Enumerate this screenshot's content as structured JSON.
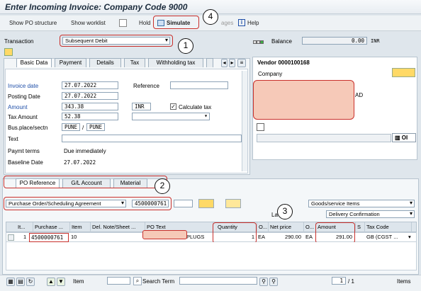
{
  "title": "Enter Incoming Invoice: Company Code 9000",
  "toolbar": {
    "show_po": "Show PO structure",
    "show_worklist": "Show worklist",
    "hold": "Hold",
    "simulate": "Simulate",
    "messages": "ages",
    "help": "Help"
  },
  "header": {
    "transaction_label": "Transaction",
    "transaction_value": "Subsequent Debit",
    "balance_label": "Balance",
    "balance_value": "0.00",
    "currency": "INR"
  },
  "tabs": [
    "Basic Data",
    "Payment",
    "Details",
    "Tax",
    "Withholding tax"
  ],
  "basic": {
    "invoice_date_label": "Invoice date",
    "invoice_date": "27.07.2022",
    "reference_label": "Reference",
    "posting_date_label": "Posting Date",
    "posting_date": "27.07.2022",
    "amount_label": "Amount",
    "amount": "343.38",
    "amount_curr": "INR",
    "calc_tax": "Calculate tax",
    "tax_amount_label": "Tax Amount",
    "tax_amount": "52.38",
    "bus_place_label": "Bus.place/sectn",
    "bus_place": "PUNE",
    "section": "PUNE",
    "text_label": "Text",
    "paymt_label": "Paymt terms",
    "paymt_value": "Due immediately",
    "baseline_label": "Baseline Date",
    "baseline_value": "27.07.2022"
  },
  "vendor": {
    "title": "Vendor 0000100168",
    "company_label": "Company",
    "partial": "AD",
    "oi": "OI"
  },
  "po_tabs": [
    "PO Reference",
    "G/L Account",
    "Material"
  ],
  "po": {
    "ref_type": "Purchase Order/Scheduling Agreement",
    "po_number": "4500000761",
    "goods": "Goods/service Items",
    "delivery": "Delivery Confirmation",
    "layout": "La"
  },
  "grid": {
    "headers": [
      "It...",
      "Purchase ...",
      "Item",
      "Del. Note/Sheet ...",
      "PO Text",
      "Quantity",
      "O...",
      "Net price",
      "O...",
      "Amount",
      "S",
      "Tax Code"
    ],
    "row": {
      "it": "1",
      "po": "4500000761",
      "item": "10",
      "po_text": "PLUGS",
      "quantity": "1",
      "ord_unit": "EA",
      "net_price": "290.00",
      "price_unit": "EA",
      "amount": "291.00",
      "tax_code": "GB (CGST ..."
    }
  },
  "footer": {
    "item_label": "Item",
    "search_label": "Search Term",
    "page": "1",
    "total": "/ 1",
    "items": "Items"
  },
  "callouts": [
    "1",
    "2",
    "3",
    "4"
  ],
  "colors": {
    "annotation": "#c9302c",
    "redaction": "#f6c9b8"
  }
}
